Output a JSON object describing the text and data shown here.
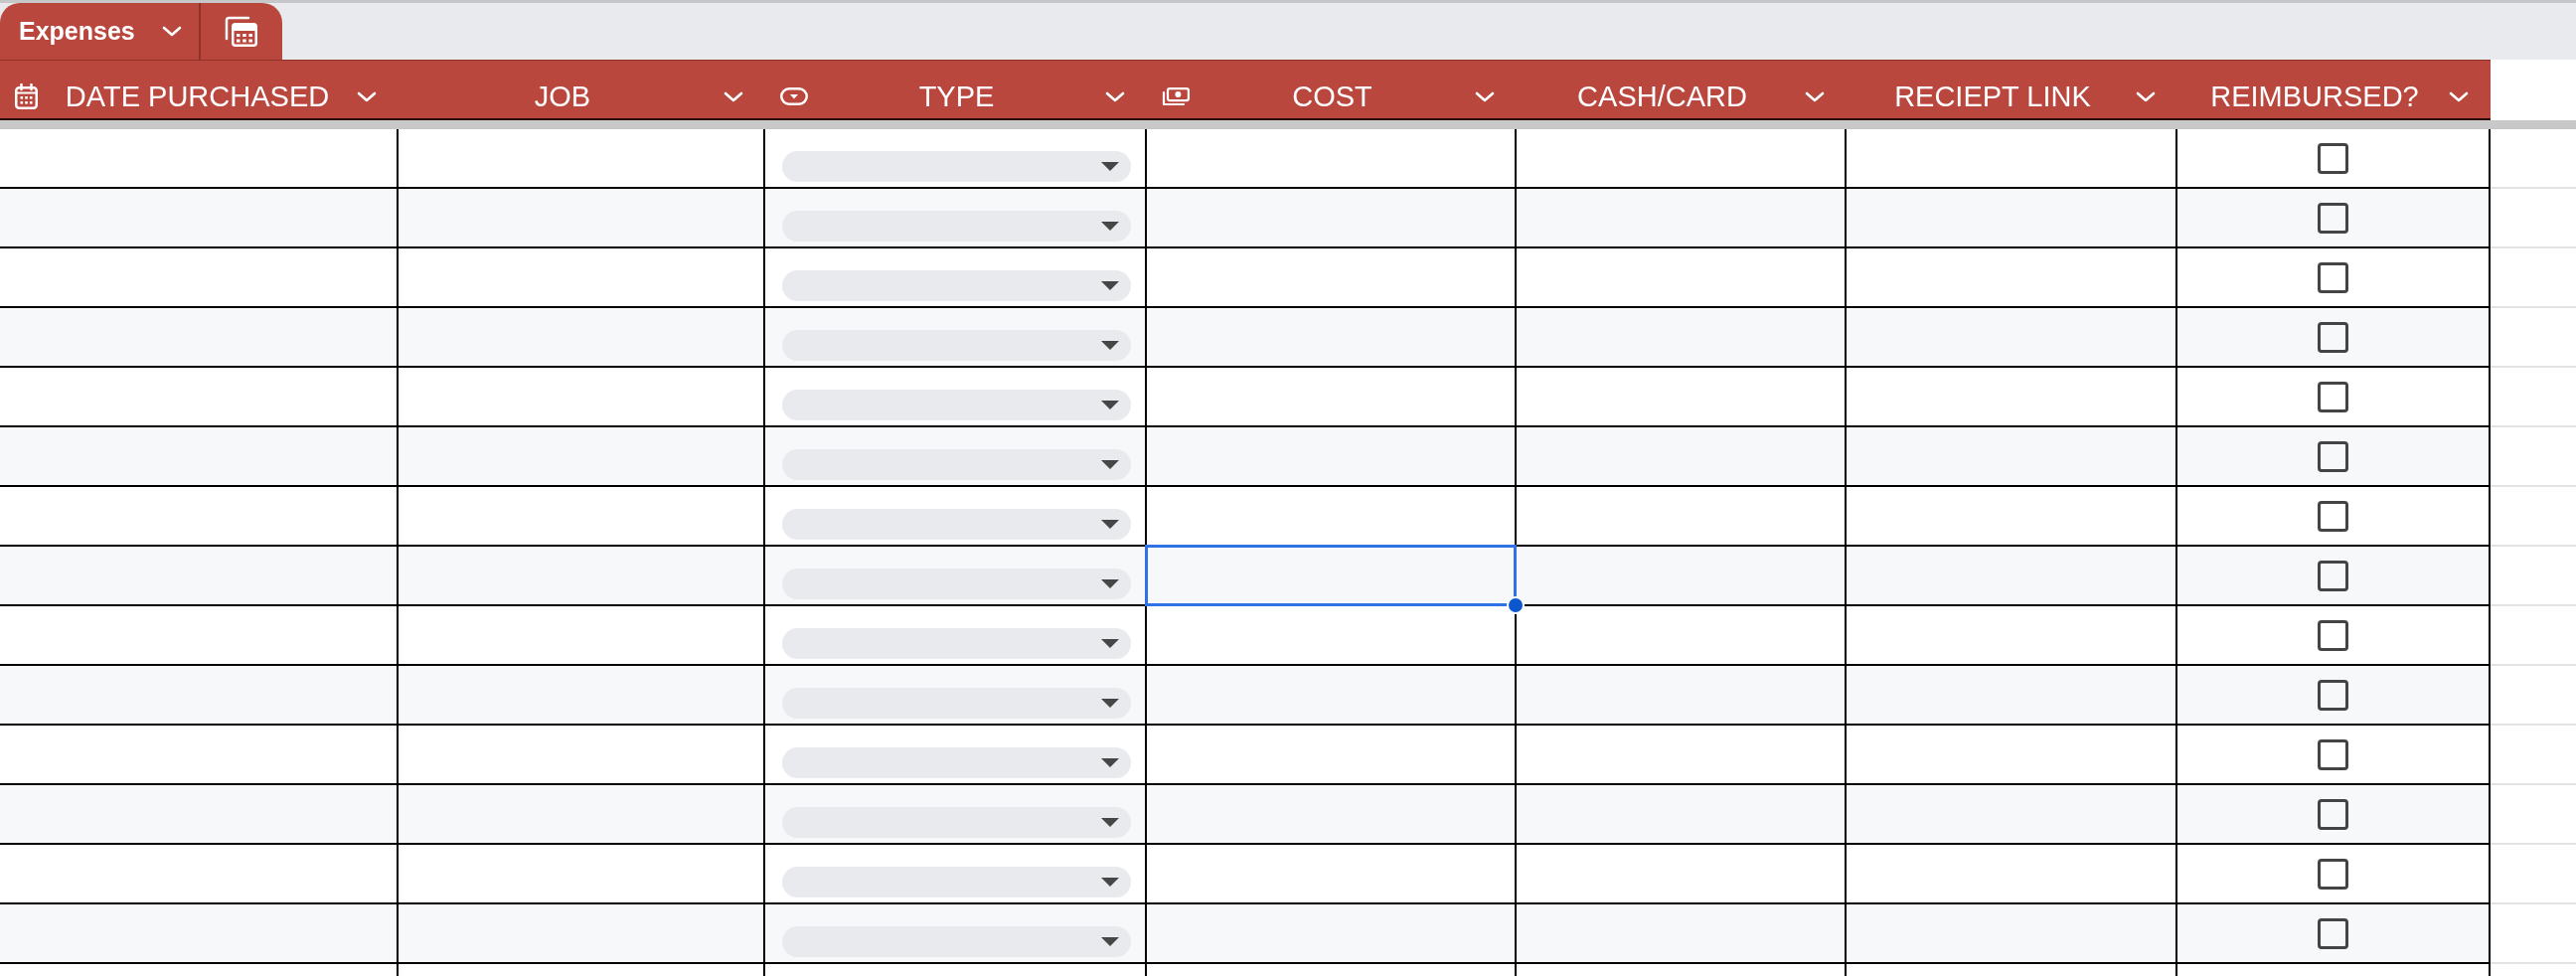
{
  "table_tab": {
    "label": "Expenses"
  },
  "columns": [
    {
      "label": "DATE PURCHASED",
      "kind": "date"
    },
    {
      "label": "JOB",
      "kind": "text"
    },
    {
      "label": "TYPE",
      "kind": "select"
    },
    {
      "label": "COST",
      "kind": "currency"
    },
    {
      "label": "CASH/CARD",
      "kind": "text"
    },
    {
      "label": "RECIEPT LINK",
      "kind": "text"
    },
    {
      "label": "REIMBURSED?",
      "kind": "checkbox"
    }
  ],
  "rows": [
    {
      "cells": [
        {
          "selected": false
        },
        {
          "selected": false
        },
        {
          "selected": false
        },
        {
          "selected": false
        },
        {
          "selected": false
        },
        {
          "selected": false
        },
        {
          "selected": false,
          "checked": false
        }
      ]
    },
    {
      "cells": [
        {
          "selected": false
        },
        {
          "selected": false
        },
        {
          "selected": false
        },
        {
          "selected": false
        },
        {
          "selected": false
        },
        {
          "selected": false
        },
        {
          "selected": false,
          "checked": false
        }
      ]
    },
    {
      "cells": [
        {
          "selected": false
        },
        {
          "selected": false
        },
        {
          "selected": false
        },
        {
          "selected": false
        },
        {
          "selected": false
        },
        {
          "selected": false
        },
        {
          "selected": false,
          "checked": false
        }
      ]
    },
    {
      "cells": [
        {
          "selected": false
        },
        {
          "selected": false
        },
        {
          "selected": false
        },
        {
          "selected": false
        },
        {
          "selected": false
        },
        {
          "selected": false
        },
        {
          "selected": false,
          "checked": false
        }
      ]
    },
    {
      "cells": [
        {
          "selected": false
        },
        {
          "selected": false
        },
        {
          "selected": false
        },
        {
          "selected": false
        },
        {
          "selected": false
        },
        {
          "selected": false
        },
        {
          "selected": false,
          "checked": false
        }
      ]
    },
    {
      "cells": [
        {
          "selected": false
        },
        {
          "selected": false
        },
        {
          "selected": false
        },
        {
          "selected": false
        },
        {
          "selected": false
        },
        {
          "selected": false
        },
        {
          "selected": false,
          "checked": false
        }
      ]
    },
    {
      "cells": [
        {
          "selected": false
        },
        {
          "selected": false
        },
        {
          "selected": false
        },
        {
          "selected": false
        },
        {
          "selected": false
        },
        {
          "selected": false
        },
        {
          "selected": false,
          "checked": false
        }
      ]
    },
    {
      "cells": [
        {
          "selected": false
        },
        {
          "selected": false
        },
        {
          "selected": false
        },
        {
          "selected": true
        },
        {
          "selected": false
        },
        {
          "selected": false
        },
        {
          "selected": false,
          "checked": false
        }
      ]
    },
    {
      "cells": [
        {
          "selected": false
        },
        {
          "selected": false
        },
        {
          "selected": false
        },
        {
          "selected": false
        },
        {
          "selected": false
        },
        {
          "selected": false
        },
        {
          "selected": false,
          "checked": false
        }
      ]
    },
    {
      "cells": [
        {
          "selected": false
        },
        {
          "selected": false
        },
        {
          "selected": false
        },
        {
          "selected": false
        },
        {
          "selected": false
        },
        {
          "selected": false
        },
        {
          "selected": false,
          "checked": false
        }
      ]
    },
    {
      "cells": [
        {
          "selected": false
        },
        {
          "selected": false
        },
        {
          "selected": false
        },
        {
          "selected": false
        },
        {
          "selected": false
        },
        {
          "selected": false
        },
        {
          "selected": false,
          "checked": false
        }
      ]
    },
    {
      "cells": [
        {
          "selected": false
        },
        {
          "selected": false
        },
        {
          "selected": false
        },
        {
          "selected": false
        },
        {
          "selected": false
        },
        {
          "selected": false
        },
        {
          "selected": false,
          "checked": false
        }
      ]
    },
    {
      "cells": [
        {
          "selected": false
        },
        {
          "selected": false
        },
        {
          "selected": false
        },
        {
          "selected": false
        },
        {
          "selected": false
        },
        {
          "selected": false
        },
        {
          "selected": false,
          "checked": false
        }
      ]
    },
    {
      "cells": [
        {
          "selected": false
        },
        {
          "selected": false
        },
        {
          "selected": false
        },
        {
          "selected": false
        },
        {
          "selected": false
        },
        {
          "selected": false
        },
        {
          "selected": false,
          "checked": false
        }
      ]
    }
  ]
}
